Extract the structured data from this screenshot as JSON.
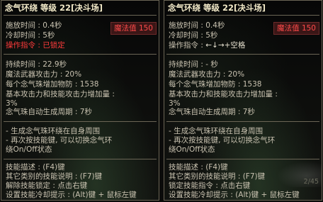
{
  "left": {
    "title": "念气环绕 等级 22[决斗场]",
    "cast_time": "施放时间 : 0.4秒",
    "cooldown": "冷却时间 : 5秒",
    "mp_label": "魔法值 150",
    "command_label": "操作指令 : ",
    "command_value": "已锁定",
    "duration": "持续时间 : 22.9秒",
    "magic_attack": "魔法武器攻击力 : 20%",
    "per_orb_defense": "每个念气珠增加物防 : 1538",
    "base_attack_line1": "基本攻击力和技能攻击力增加量 :",
    "base_attack_line2": "3%",
    "orb_period": "念气珠自动生成周期 : 7秒",
    "desc1": "- 生成念气珠环绕在自身周围",
    "desc2": "- 再次按技能键, 可以切换念气环",
    "desc3": "绕On/Off状态",
    "help1": "技能描述 : (F4)键",
    "help2": "其它类别的技能说明 : (F7)键",
    "help3": "解除技能锁定 : 点击右键",
    "help4": "设置技能冷却提示 : (Alt)键 + 鼠标左键"
  },
  "right": {
    "title": "念气环绕 等级 22[决斗场]",
    "cast_time": "施放时间 : 0.4秒",
    "cooldown": "冷却时间 : 5秒",
    "mp_label": "魔法值 150",
    "command_label": "操作指令 : ",
    "command_value": "←↓→+空格",
    "duration": "持续时间 : - 秒",
    "magic_attack": "魔法武器攻击力 : 20%",
    "per_orb_defense": "每个念气珠增加物防 : 1538",
    "base_attack_line1": "基本攻击力和技能攻击力增加量 :",
    "base_attack_line2": "3%",
    "orb_period": "念气珠自动生成周期 : 7秒",
    "desc1": "- 生成念气珠环绕在自身周围",
    "desc2": "- 再次按技能键, 可以切换念气环",
    "desc3": "绕On/Off状态",
    "help1": "技能描述 : (F4)键",
    "help2": "其它类别的技能说明 : (F7)键",
    "help3": "锁定技能指令 : 点击右键",
    "help4": "设置技能冷却提示 : (Alt)键 + 鼠标左键",
    "page": "2/45"
  },
  "colors": {
    "accent_red": "#ff3b3b",
    "title": "#f2e9c8",
    "text": "#c9c2b0",
    "border": "#6b6555"
  }
}
